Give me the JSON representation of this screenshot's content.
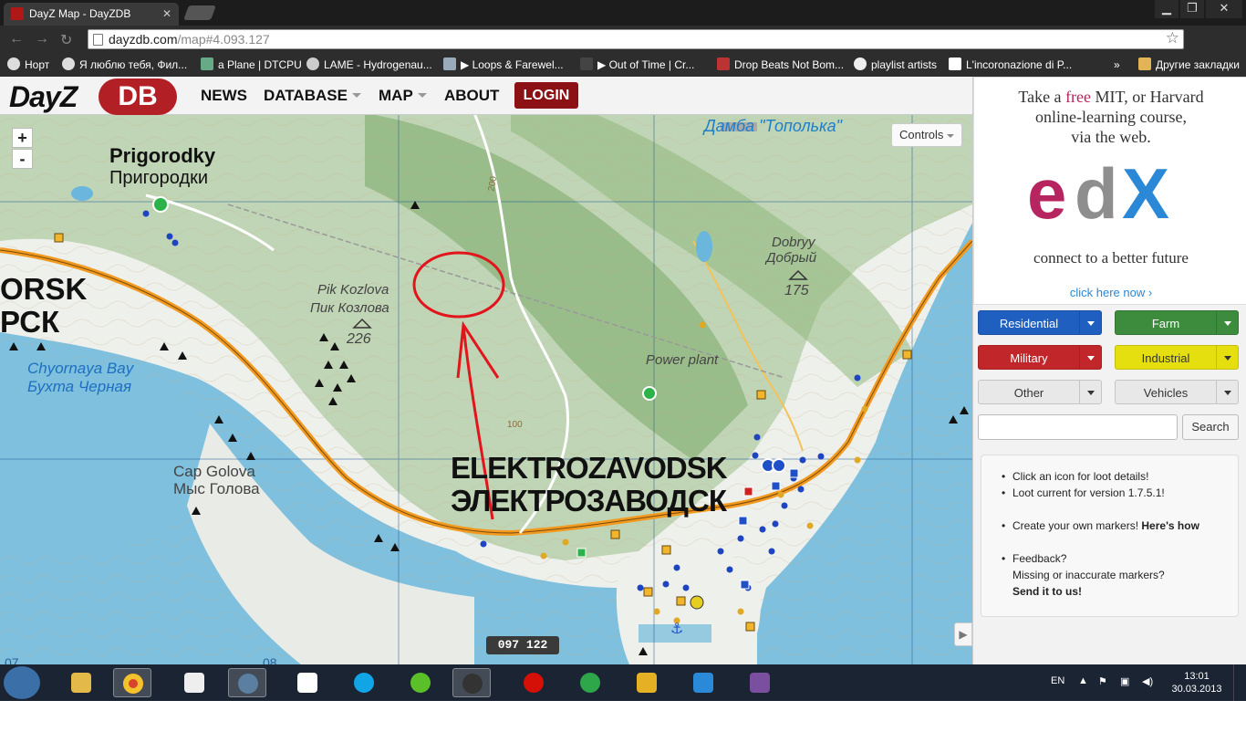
{
  "browser": {
    "tab_title": "DayZ Map - DayZDB",
    "url_host": "dayzdb.com",
    "url_path": "/map#4.093.127",
    "bookmarks": [
      {
        "label": "Норт"
      },
      {
        "label": "Я люблю тебя, Фил..."
      },
      {
        "label": "a Plane | DTCPU"
      },
      {
        "label": "LAME - Hydrogenau..."
      },
      {
        "label": "▶ Loops & Farewel..."
      },
      {
        "label": "▶ Out of Time | Cr..."
      },
      {
        "label": "Drop Beats Not Bom..."
      },
      {
        "label": "playlist artists"
      },
      {
        "label": "L'incoronazione di P..."
      }
    ],
    "overflow": "»",
    "other_bookmarks": "Другие закладки"
  },
  "site": {
    "logo_left": "DayZ",
    "logo_right": "DB",
    "nav": {
      "news": "NEWS",
      "database": "DATABASE",
      "map": "MAP",
      "about": "ABOUT",
      "login": "LOGIN"
    }
  },
  "map": {
    "zoom_in": "+",
    "zoom_out": "-",
    "controls": "Controls",
    "coordinates": "097 122",
    "labels": {
      "prigorodky_en": "Prigorodky",
      "prigorodky_ru": "Пригородки",
      "dam": "Дамба \"Тополька\"",
      "orsk_en": "ORSK",
      "orsk_ru": "РСК",
      "pik_en": "Pik Kozlova",
      "pik_ru": "Пик Козлова",
      "pik_height": "226",
      "dobryy_en": "Dobryy",
      "dobryy_ru": "Добрый",
      "dobryy_height": "175",
      "power_plant": "Power plant",
      "bay_en": "Chyornaya Bay",
      "bay_ru": "Бухта Черная",
      "cap_en": "Cap Golova",
      "cap_ru": "Мыс Голова",
      "elektro_en": "ELEKTROZAVODSK",
      "elektro_ru": "ЭЛЕКТРОЗАВОДСК",
      "contour_200": "200",
      "contour_100": "100",
      "grid_left": "07",
      "grid_mid": "08"
    },
    "annotation_color": "#e2141c"
  },
  "sidebar": {
    "ad": {
      "line1_pre": "Take a ",
      "line1_free": "free",
      "line1_post": " MIT, or Harvard",
      "line2": "online-learning course,",
      "line3": "via the web.",
      "brand": "edX",
      "tagline": "connect to a better future",
      "cta": "click here now ›"
    },
    "filters": [
      {
        "label": "Residential",
        "color": "#1f5fbf",
        "text": "#ffffff"
      },
      {
        "label": "Farm",
        "color": "#3d8b3d",
        "text": "#ffffff"
      },
      {
        "label": "Military",
        "color": "#c0262a",
        "text": "#ffffff"
      },
      {
        "label": "Industrial",
        "color": "#e6df10",
        "text": "#333333"
      },
      {
        "label": "Other",
        "color": "#e8e8e8",
        "text": "#333333"
      },
      {
        "label": "Vehicles",
        "color": "#e8e8e8",
        "text": "#333333"
      }
    ],
    "search_placeholder": "",
    "search_button": "Search",
    "info": {
      "l1": "Click an icon for loot details!",
      "l2": "Loot current for version 1.7.5.1!",
      "l3_pre": "Create your own markers! ",
      "l3_link": "Here's how",
      "l4": "Feedback?",
      "l5": "Missing or inaccurate markers?",
      "l6": "Send it to us!"
    }
  },
  "taskbar": {
    "lang": "EN",
    "time": "13:01",
    "date": "30.03.2013"
  }
}
